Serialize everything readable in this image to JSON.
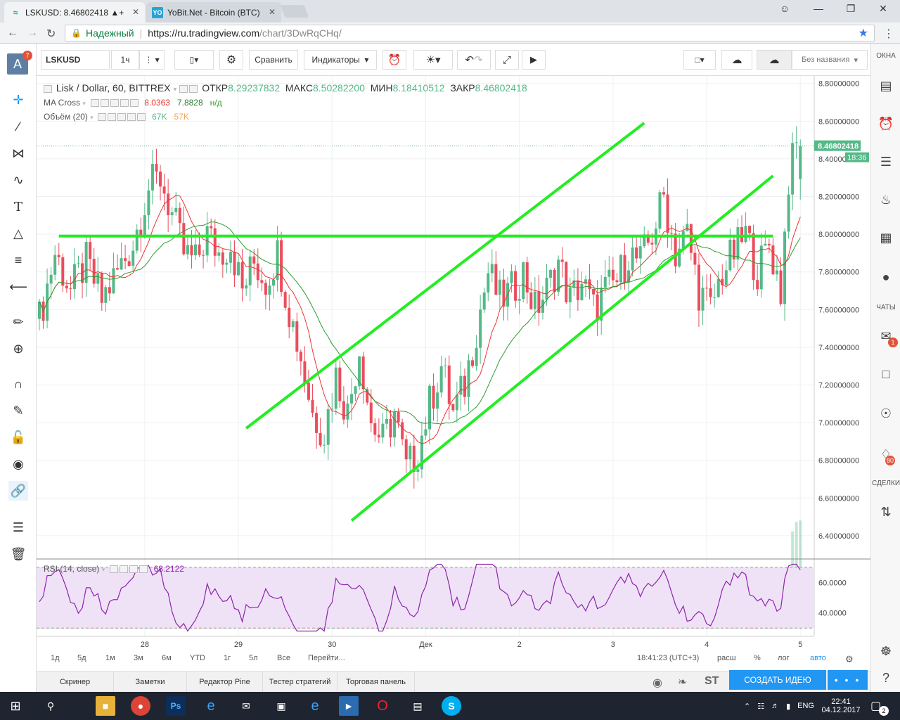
{
  "browser": {
    "tabs": [
      {
        "title": "LSKUSD: 8.46802418 ▲+",
        "active": true
      },
      {
        "title": "YoBit.Net - Bitcoin (BTC)",
        "active": false,
        "favicon_text": "YO"
      }
    ],
    "secure_label": "Надежный",
    "url_host": "https://ru.tradingview.com",
    "url_path": "/chart/3DwRqCHq/"
  },
  "left_tools": {
    "avatar_letter": "A",
    "avatar_badge": "7"
  },
  "toolbar": {
    "symbol": "LSKUSD",
    "interval": "1ч",
    "compare_label": "Сравнить",
    "indicators_label": "Индикаторы",
    "layout_name": "Без названия"
  },
  "right_panel": {
    "windows_label": "ОКНА",
    "chats_label": "ЧАТЫ",
    "deals_label": "СДЕЛКИ",
    "chat_badge": "1",
    "alerts_badge": "80"
  },
  "legend": {
    "name": "Lisk / Dollar, 60, BITTREX",
    "open_label": "ОТКР",
    "open": "8.29237832",
    "high_label": "МАКС",
    "high": "8.50282200",
    "low_label": "МИН",
    "low": "8.18410512",
    "close_label": "ЗАКР",
    "close": "8.46802418",
    "ma_label": "MA Cross",
    "ma_v1": "8.0363",
    "ma_v2": "7.8828",
    "ma_v3": "н/д",
    "vol_label": "Объём (20)",
    "vol_v1": "67K",
    "vol_v2": "57K",
    "rsi_label": "RSI (14, close)",
    "rsi_value": "68.2122"
  },
  "price_tag": {
    "price": "8.46802418",
    "time": "18:36"
  },
  "colors": {
    "up": "#53b987",
    "down": "#eb4d5c",
    "trend": "#22ee22",
    "ma_fast": "#ee3333",
    "ma_slow": "#2e9d2e",
    "volume_ma": "#f5a35a",
    "rsi_line": "#8e24aa",
    "rsi_band": "#efe2f7",
    "accent": "#2196f3"
  },
  "chart_data": {
    "type": "candlestick",
    "ylim": [
      6.28,
      8.84
    ],
    "yticks": [
      "8.80000000",
      "8.60000000",
      "8.40000000",
      "8.20000000",
      "8.00000000",
      "7.80000000",
      "7.60000000",
      "7.40000000",
      "7.20000000",
      "7.00000000",
      "6.80000000",
      "6.60000000",
      "6.40000000"
    ],
    "ytick_values": [
      8.8,
      8.6,
      8.4,
      8.2,
      8.0,
      7.8,
      7.6,
      7.4,
      7.2,
      7.0,
      6.8,
      6.6,
      6.4
    ],
    "xticks": [
      "28",
      "29",
      "30",
      "Дек",
      "2",
      "3",
      "4",
      "5"
    ],
    "xtick_index": [
      27,
      51,
      75,
      99,
      123,
      147,
      171,
      195
    ],
    "waypoints": [
      [
        0,
        7.55
      ],
      [
        4,
        7.9
      ],
      [
        8,
        7.7
      ],
      [
        12,
        7.85
      ],
      [
        16,
        7.65
      ],
      [
        20,
        7.8
      ],
      [
        24,
        7.95
      ],
      [
        28,
        8.25
      ],
      [
        31,
        8.3
      ],
      [
        34,
        8.1
      ],
      [
        37,
        7.9
      ],
      [
        40,
        7.85
      ],
      [
        43,
        8.0
      ],
      [
        46,
        7.9
      ],
      [
        49,
        7.95
      ],
      [
        52,
        7.7
      ],
      [
        55,
        7.85
      ],
      [
        58,
        7.75
      ],
      [
        61,
        7.9
      ],
      [
        64,
        7.6
      ],
      [
        67,
        7.35
      ],
      [
        70,
        7.05
      ],
      [
        73,
        6.95
      ],
      [
        76,
        7.25
      ],
      [
        79,
        7.05
      ],
      [
        82,
        7.4
      ],
      [
        85,
        7.0
      ],
      [
        88,
        6.9
      ],
      [
        91,
        7.05
      ],
      [
        94,
        6.75
      ],
      [
        97,
        6.85
      ],
      [
        100,
        7.1
      ],
      [
        103,
        7.3
      ],
      [
        106,
        7.05
      ],
      [
        109,
        7.2
      ],
      [
        112,
        7.5
      ],
      [
        115,
        7.8
      ],
      [
        118,
        7.65
      ],
      [
        121,
        7.7
      ],
      [
        124,
        7.8
      ],
      [
        127,
        7.6
      ],
      [
        130,
        7.7
      ],
      [
        133,
        7.85
      ],
      [
        136,
        7.65
      ],
      [
        139,
        7.75
      ],
      [
        142,
        7.6
      ],
      [
        145,
        7.7
      ],
      [
        148,
        7.75
      ],
      [
        151,
        7.9
      ],
      [
        154,
        7.85
      ],
      [
        157,
        8.0
      ],
      [
        160,
        8.2
      ],
      [
        163,
        7.9
      ],
      [
        166,
        8.0
      ],
      [
        169,
        7.7
      ],
      [
        172,
        7.6
      ],
      [
        175,
        7.8
      ],
      [
        178,
        7.9
      ],
      [
        181,
        8.0
      ],
      [
        184,
        7.8
      ],
      [
        187,
        7.95
      ],
      [
        190,
        7.7
      ],
      [
        192,
        8.3
      ],
      [
        194,
        8.46
      ]
    ],
    "rsi_ylim": [
      25,
      75
    ],
    "rsi_yticks": [
      "60.0000",
      "40.0000"
    ],
    "rsi_ytick_values": [
      60,
      40
    ],
    "rsi_bands": [
      70,
      30
    ],
    "rsi_last": 68.2122,
    "horizontal_line": 7.99,
    "trendlines": [
      [
        [
          53,
          6.97
        ],
        [
          155,
          8.59
        ]
      ],
      [
        [
          80,
          6.48
        ],
        [
          188,
          8.31
        ]
      ],
      [
        [
          5,
          7.99
        ],
        [
          188,
          7.99
        ]
      ]
    ]
  },
  "bottom": {
    "ranges": [
      "1д",
      "5д",
      "1м",
      "3м",
      "6м",
      "YTD",
      "1г",
      "5л",
      "Все"
    ],
    "goto_label": "Перейти...",
    "time": "18:41:23 (UTC+3)",
    "scale": "расш",
    "percent": "%",
    "log": "лог",
    "auto": "авто",
    "panel_tabs": [
      "Скринер",
      "Заметки",
      "Редактор Pine",
      "Тестер стратегий",
      "Торговая панель"
    ],
    "tw": "ST",
    "idea_label": "СОЗДАТЬ ИДЕЮ",
    "idea_more": "• • •"
  },
  "taskbar": {
    "lang": "ENG",
    "time": "22:41",
    "date": "04.12.2017",
    "notif": "2"
  }
}
